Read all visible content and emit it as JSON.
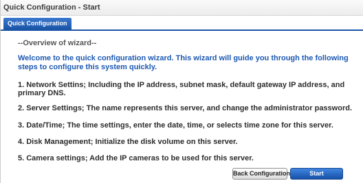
{
  "window": {
    "title": "Quick Configuration - Start"
  },
  "tabs": [
    {
      "label": "Quick Configuration",
      "active": true
    }
  ],
  "wizard": {
    "overview_heading": "--Overview of wizard--",
    "welcome_text": "Welcome to the quick configuration wizard. This wizard will guide you through the following steps to configure this system quickly.",
    "steps": [
      "1. Network Settins; Including the IP address, subnet mask, default gateway IP address, and primary DNS.",
      "2. Server Settings; The name represents this server, and change the administrator password.",
      "3. Date/Time; The time settings, enter the date, time, or selects time zone for this server.",
      "4. Disk Management; Initialize the disk volume on this server.",
      "5. Camera settings; Add the IP cameras to be used for this server."
    ]
  },
  "buttons": {
    "back_label": "Back Configuration",
    "start_label": "Start"
  },
  "colors": {
    "accent": "#1a54a6",
    "welcome_text": "#1c58b1"
  }
}
